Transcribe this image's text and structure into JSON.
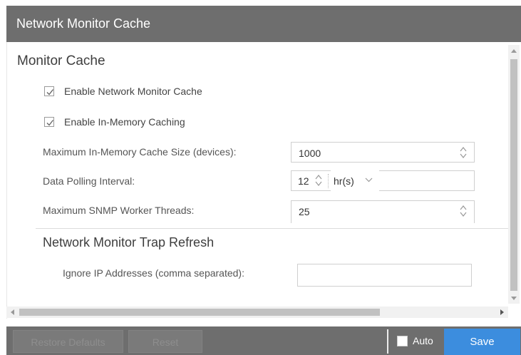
{
  "window": {
    "title": "Network Monitor Cache"
  },
  "monitor_cache": {
    "heading": "Monitor Cache",
    "checkboxes": [
      {
        "label": "Enable Network Monitor Cache",
        "checked": true
      },
      {
        "label": "Enable In-Memory Caching",
        "checked": true
      }
    ],
    "fields": {
      "max_cache_size": {
        "label": "Maximum In-Memory Cache Size (devices):",
        "value": "1000"
      },
      "polling_interval": {
        "label": "Data Polling Interval:",
        "value": "12",
        "unit": "hr(s)"
      },
      "worker_threads": {
        "label": "Maximum SNMP Worker Threads:",
        "value": "25"
      }
    }
  },
  "trap_refresh": {
    "heading": "Network Monitor Trap Refresh",
    "ignore_ip": {
      "label": "Ignore IP Addresses (comma separated):",
      "value": ""
    }
  },
  "footer": {
    "restore_defaults": "Restore Defaults",
    "reset": "Reset",
    "auto_label": "Auto",
    "auto_checked": false,
    "save": "Save"
  },
  "colors": {
    "titlebar": "#6e6e6e",
    "footer": "#6e6e6e",
    "save_button": "#3c8dde"
  }
}
